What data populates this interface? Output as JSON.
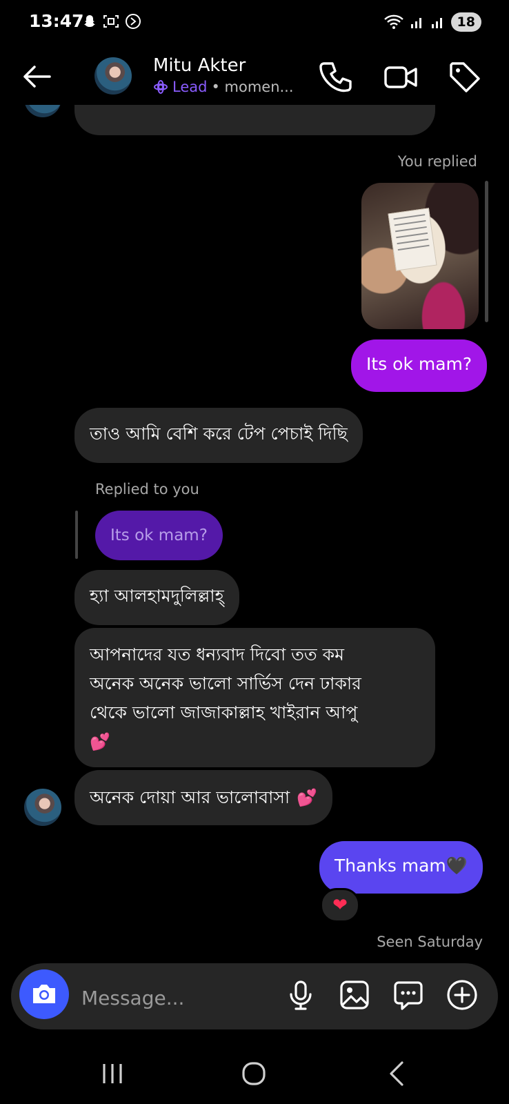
{
  "status_bar": {
    "time": "13:47",
    "battery": "18"
  },
  "header": {
    "contact_name": "Mitu Akter",
    "label": "Lead",
    "activity": "• momen...",
    "accent_color": "#8a5cff"
  },
  "messages": {
    "you_replied": "You replied",
    "outgoing_1": "Its ok mam?",
    "incoming_1": "তাও আমি বেশি করে টেপ পেচাই দিছি",
    "replied_to_you": "Replied to you",
    "quoted_text": "Its ok mam?",
    "incoming_2": "হ্যা আলহামদুলিল্লাহ্",
    "incoming_3_line1": "আপনাদের যত ধন্যবাদ দিবো তত কম",
    "incoming_3_line2": "অনেক অনেক ভালো সার্ভিস দেন ঢাকার",
    "incoming_3_line3": "থেকে ভালো জাজাকাল্লাহ খাইরান আপু",
    "incoming_3_emoji": "💕",
    "incoming_4": "অনেক দোয়া আর ভালোবাসা",
    "incoming_4_emoji": "💕",
    "outgoing_2": "Thanks mam🖤",
    "reaction": "❤",
    "seen": "Seen Saturday"
  },
  "composer": {
    "placeholder": "Message..."
  },
  "colors": {
    "outgoing_purple": "#a116e8",
    "outgoing_blue": "#5a45f0",
    "incoming_bubble": "#262626",
    "camera_button": "#3d5afe"
  }
}
